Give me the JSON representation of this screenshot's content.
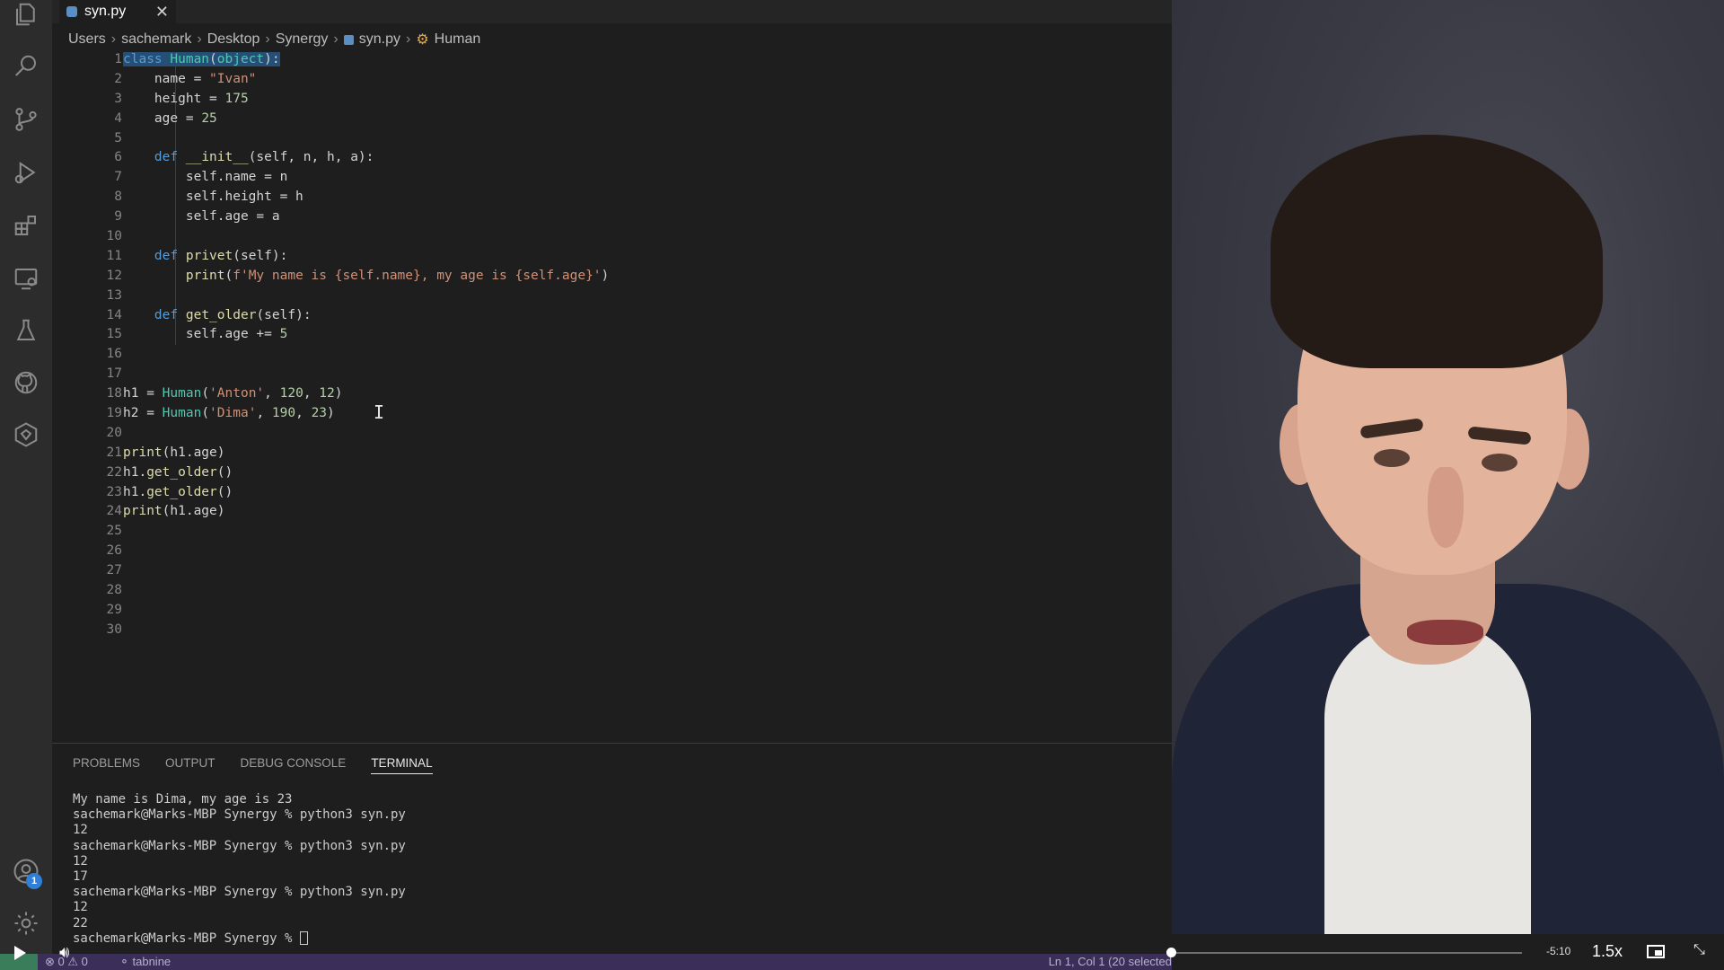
{
  "tab": {
    "filename": "syn.py",
    "close": "✕"
  },
  "breadcrumb": [
    "Users",
    "sachemark",
    "Desktop",
    "Synergy",
    "syn.py",
    "Human"
  ],
  "code": {
    "line_numbers": [
      "1",
      "2",
      "3",
      "4",
      "5",
      "6",
      "7",
      "8",
      "9",
      "10",
      "11",
      "12",
      "13",
      "14",
      "15",
      "16",
      "17",
      "18",
      "19",
      "20",
      "21",
      "22",
      "23",
      "24",
      "25",
      "26",
      "27",
      "28",
      "29",
      "30"
    ],
    "lines": [
      "class Human(object):",
      "    name = \"Ivan\"",
      "    height = 175",
      "    age = 25",
      "",
      "    def __init__(self, n, h, a):",
      "        self.name = n",
      "        self.height = h",
      "        self.age = a",
      "",
      "    def privet(self):",
      "        print(f'My name is {self.name}, my age is {self.age}')",
      "",
      "    def get_older(self):",
      "        self.age += 5",
      "",
      "",
      "h1 = Human('Anton', 120, 12)",
      "h2 = Human('Dima', 190, 23)",
      "",
      "print(h1.age)",
      "h1.get_older()",
      "h1.get_older()",
      "print(h1.age)",
      "",
      "",
      "",
      "",
      "",
      ""
    ],
    "selection": "class Human(object):"
  },
  "panel": {
    "tabs": [
      "PROBLEMS",
      "OUTPUT",
      "DEBUG CONSOLE",
      "TERMINAL"
    ],
    "active_tab": "TERMINAL",
    "terminal": [
      "My name is Dima, my age is 23",
      "sachemark@Marks-MBP Synergy % python3 syn.py",
      "12",
      "sachemark@Marks-MBP Synergy % python3 syn.py",
      "12",
      "17",
      "sachemark@Marks-MBP Synergy % python3 syn.py",
      "12",
      "22"
    ],
    "prompt": "sachemark@Marks-MBP Synergy % "
  },
  "statusbar": {
    "errors": "⊗ 0 ⚠ 0",
    "tabnine": "⚬ tabnine",
    "position": "Ln 1, Col 1 (20 selected"
  },
  "activity": {
    "account_badge": "1"
  },
  "video": {
    "remaining": "-5:10",
    "speed": "1.5x",
    "progress": 0.0
  },
  "colors": {
    "keyword": "#569cd6",
    "class": "#4ec9b0",
    "string": "#ce9178",
    "number": "#b5cea8",
    "function": "#dcdcaa",
    "selection": "#264f78",
    "status_bg": "#3b2f5a"
  }
}
